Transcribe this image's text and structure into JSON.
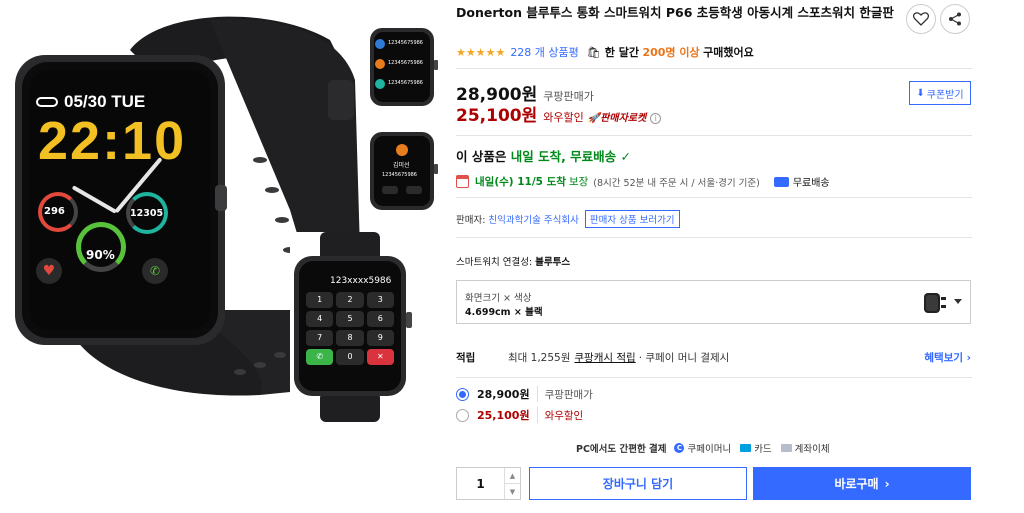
{
  "product": {
    "brand": "Donerton",
    "title": "블루투스 통화 스마트워치 P66 초등학생 아동시계 스포츠워치 한글판",
    "rating_stars": "★★★★★",
    "review_count": "228 개 상품평",
    "purchase_prefix": "한 달간",
    "purchase_count": "200명 이상",
    "purchase_suffix": "구매했어요"
  },
  "watch_faces": {
    "date": "05/30 TUE",
    "time": "22:10",
    "kcal": "296",
    "steps": "12305",
    "battery": "90%",
    "thumb1_number": "12345675986",
    "thumb2_name": "김미선",
    "thumb2_number": "12345675986",
    "dialer_number": "123xxxx5986",
    "dialer_keys": [
      "1",
      "2",
      "3",
      "4",
      "5",
      "6",
      "7",
      "8",
      "9",
      "0"
    ]
  },
  "prices": {
    "price": "28,900원",
    "price_label": "쿠팡판매가",
    "wow_price": "25,100원",
    "wow_label": "와우할인",
    "rocket_label": "판매자로켓",
    "coupon_button": "쿠폰받기"
  },
  "delivery": {
    "head_prefix": "이 상품은",
    "head_highlight": "내일 도착, 무료배송",
    "arrive": "내일(수) 11/5 도착",
    "guarantee": "보장",
    "note": "(8시간 52분 내 주문 시 / 서울·경기 기준)",
    "free_ship": "무료배송"
  },
  "seller": {
    "label": "판매자:",
    "name": "친익과학기술 주식회사",
    "button": "판매자 상품 보러가기"
  },
  "options": {
    "connectivity_label": "스마트워치 연결성:",
    "connectivity_value": "블루투스",
    "option_line1": "화면크기 × 색상",
    "option_line2": "4.699cm × 블랙"
  },
  "reward": {
    "label": "적립",
    "text": "최대 1,255원",
    "link": "쿠팡캐시 적립",
    "rest": "· 쿠페이 머니 결제시",
    "more": "혜택보기 ›"
  },
  "choices": [
    {
      "price": "28,900원",
      "label": "쿠팡판매가"
    },
    {
      "price": "25,100원",
      "label": "와우할인"
    }
  ],
  "payment": {
    "title": "PC에서도 간편한 결제",
    "coupay_icon": "C",
    "coupay": "쿠페이머니",
    "card": "카드",
    "bank": "계좌이체"
  },
  "purchase": {
    "quantity": "1",
    "cart_button": "장바구니 담기",
    "buy_button": "바로구매",
    "buy_arrow": "›"
  },
  "colors": {
    "accent": "#346aff",
    "wow_red": "#ae0000",
    "delivery_green": "#00891a",
    "star": "#f5a623"
  }
}
